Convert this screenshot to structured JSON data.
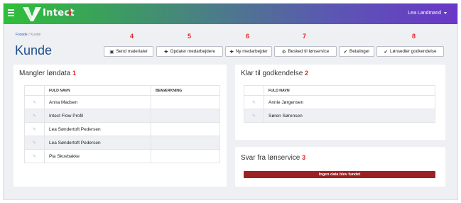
{
  "app": {
    "brand": "Intect",
    "brand_annotation": "9",
    "user_name": "Lea Landmand"
  },
  "breadcrumb": {
    "root": "Forside",
    "separator": "/",
    "current": "Kunde"
  },
  "page_title": "Kunde",
  "toolbar": {
    "buttons": [
      {
        "label": "Send materialer",
        "icon": "document-icon",
        "annotation": "4"
      },
      {
        "label": "Opdater medarbejdere",
        "icon": "plus-icon",
        "annotation": "5"
      },
      {
        "label": "Ny medarbejder",
        "icon": "plus-icon",
        "annotation": "6"
      },
      {
        "label": "Besked til lønservice",
        "icon": "gear-icon",
        "annotation": "7"
      },
      {
        "label": "Betalinger",
        "icon": "check-icon",
        "annotation": ""
      },
      {
        "label": "Lønsedler godkendelse",
        "icon": "check-icon",
        "annotation": "8"
      }
    ]
  },
  "missing_salary_data": {
    "title": "Mangler løndata",
    "annotation": "1",
    "columns": [
      "FULD NAVN",
      "BEMÆRKNING"
    ],
    "rows": [
      {
        "name": "Anna Madsen",
        "note": ""
      },
      {
        "name": "Intect Flow Profil",
        "note": ""
      },
      {
        "name": "Lea Søndertoft Pedersen",
        "note": ""
      },
      {
        "name": "Lea Søndertoft Pedersen",
        "note": ""
      },
      {
        "name": "Pia Skovbakke",
        "note": ""
      }
    ]
  },
  "ready_for_approval": {
    "title": "Klar til godkendelse",
    "annotation": "2",
    "columns": [
      "FULD NAVN"
    ],
    "rows": [
      {
        "name": "Annie Jørgensen"
      },
      {
        "name": "Søren Sørensen"
      }
    ]
  },
  "salary_service_reply": {
    "title": "Svar fra lønservice",
    "annotation": "3",
    "empty_message": "Ingen data blev fundet"
  },
  "colors": {
    "brand_gradient_start": "#2fbf3a",
    "brand_gradient_end": "#6a37c8",
    "title_blue": "#1d4f8a",
    "annotation_red": "#e02424",
    "empty_bar": "#9b2223"
  }
}
